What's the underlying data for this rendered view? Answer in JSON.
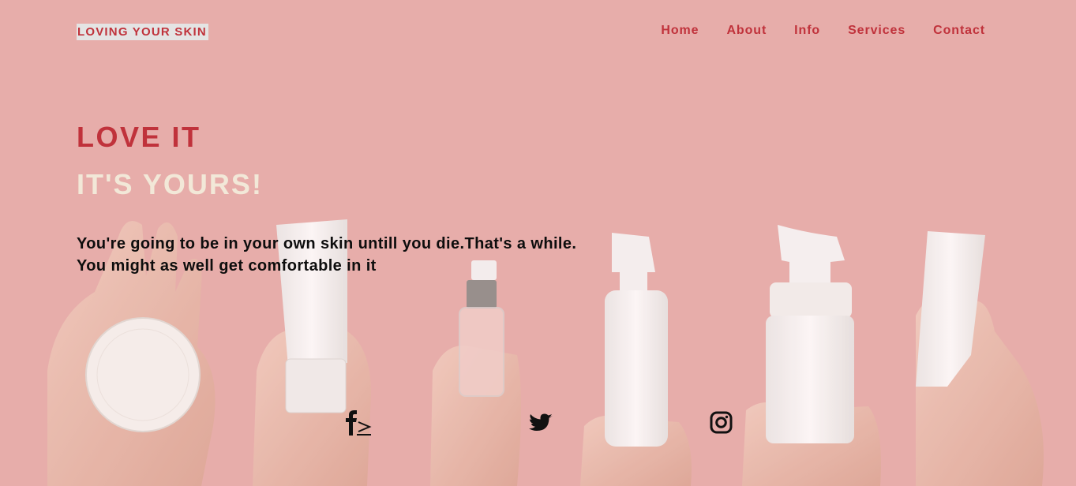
{
  "header": {
    "brand": "LOVING YOUR SKIN",
    "nav": [
      {
        "label": "Home"
      },
      {
        "label": "About"
      },
      {
        "label": "Info"
      },
      {
        "label": "Services"
      },
      {
        "label": "Contact"
      }
    ]
  },
  "hero": {
    "headline": "LOVE IT",
    "subheadline": "IT'S YOURS!",
    "tagline": "You're going to be in your own skin untill you die.That's a while. You might as well get comfortable in it"
  },
  "social": {
    "icons": [
      "facebook-icon",
      "twitter-icon",
      "instagram-icon"
    ]
  },
  "colors": {
    "background": "#e8aeaa",
    "accent": "#c0323b",
    "cream": "#f2e8d8",
    "text": "#0d0d0d"
  }
}
